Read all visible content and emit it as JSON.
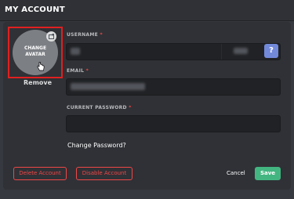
{
  "header": {
    "title": "MY ACCOUNT"
  },
  "avatar": {
    "change_label_line1": "CHANGE",
    "change_label_line2": "AVATAR",
    "remove_label": "Remove"
  },
  "form": {
    "username_label": "USERNAME",
    "email_label": "EMAIL",
    "current_password_label": "CURRENT PASSWORD",
    "required_marker": "*",
    "help_button": "?",
    "change_password_link": "Change Password?"
  },
  "footer": {
    "delete_account": "Delete Account",
    "disable_account": "Disable Account",
    "cancel": "Cancel",
    "save": "Save"
  },
  "colors": {
    "background": "#36393f",
    "panel": "#2f3136",
    "input": "#202225",
    "danger": "#f04747",
    "save": "#43b581",
    "help": "#7289da"
  }
}
